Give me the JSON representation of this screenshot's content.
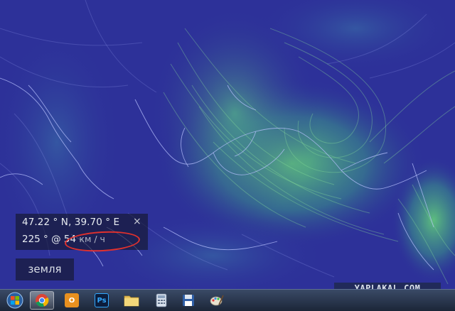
{
  "readout": {
    "coordinates": "47.22 ° N, 39.70 ° E",
    "close_symbol": "×",
    "wind_direction": "225 °",
    "wind_at": "@",
    "wind_speed": "54",
    "wind_unit": "км / ч",
    "highlight_color": "#e0312d"
  },
  "earth_button": {
    "label": "земля"
  },
  "taskbar": {
    "items": [
      {
        "name": "start-button",
        "icon": "windows-orb-icon"
      },
      {
        "name": "chrome",
        "icon": "chrome-icon",
        "active": true
      },
      {
        "name": "outlook",
        "icon": "outlook-icon",
        "label": "O"
      },
      {
        "name": "photoshop",
        "icon": "photoshop-icon",
        "label": "Ps"
      },
      {
        "name": "explorer",
        "icon": "folder-icon"
      },
      {
        "name": "calculator",
        "icon": "calculator-icon"
      },
      {
        "name": "save",
        "icon": "floppy-disk-icon"
      },
      {
        "name": "paint",
        "icon": "paint-icon"
      }
    ]
  },
  "watermark": "YAPLAKAL.COM",
  "colors": {
    "map_background": "#2d3199",
    "wind_strong": "#72e07a",
    "wind_medium": "#3f9f8a",
    "coastline": "#a7b4ff"
  }
}
